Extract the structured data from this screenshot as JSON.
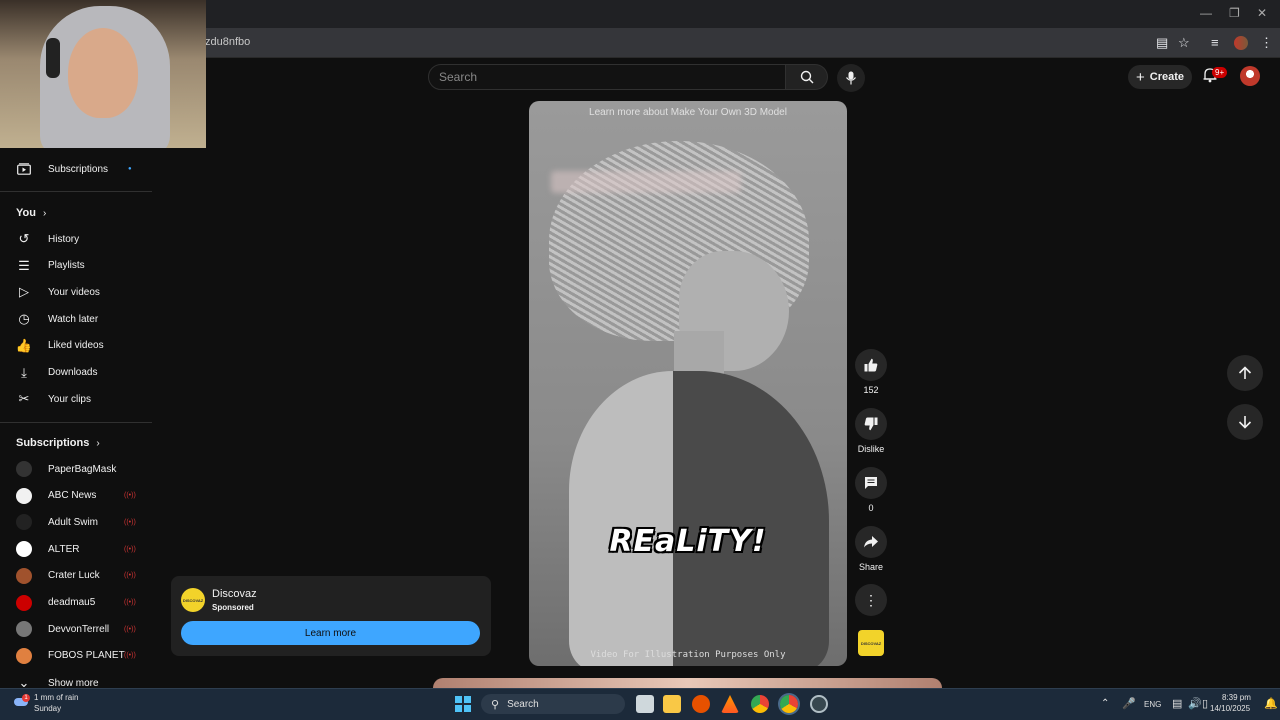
{
  "browser": {
    "url": "zdu8nfbo"
  },
  "header": {
    "search_placeholder": "Search",
    "create_label": "Create",
    "notif_count": "9+"
  },
  "sidebar": {
    "subscriptions_top": "Subscriptions",
    "you_heading": "You",
    "you_items": [
      {
        "label": "History",
        "icon": "history-icon"
      },
      {
        "label": "Playlists",
        "icon": "playlists-icon"
      },
      {
        "label": "Your videos",
        "icon": "your-videos-icon"
      },
      {
        "label": "Watch later",
        "icon": "watch-later-icon"
      },
      {
        "label": "Liked videos",
        "icon": "liked-icon"
      },
      {
        "label": "Downloads",
        "icon": "download-icon"
      },
      {
        "label": "Your clips",
        "icon": "clips-icon"
      }
    ],
    "subs_heading": "Subscriptions",
    "channels": [
      {
        "name": "PaperBagMask",
        "color": "#333333"
      },
      {
        "name": "ABC News",
        "color": "#f1f1f1"
      },
      {
        "name": "Adult Swim",
        "color": "#222222"
      },
      {
        "name": "ALTER",
        "color": "#ffffff"
      },
      {
        "name": "Crater Luck",
        "color": "#a0522d"
      },
      {
        "name": "deadmau5",
        "color": "#cc0000"
      },
      {
        "name": "DevvonTerrell",
        "color": "#777777"
      },
      {
        "name": "FOBOS PLANET",
        "color": "#e08040"
      }
    ],
    "show_more": "Show more"
  },
  "video": {
    "top_caption": "Learn more about Make Your Own 3D Model",
    "overlay_text": "REaLiTY!",
    "disclaimer": "Video For Illustration Purposes Only"
  },
  "actions": {
    "like_count": "152",
    "dislike_label": "Dislike",
    "comment_count": "0",
    "share_label": "Share",
    "ad_thumb_text": "DISCOVAZ"
  },
  "ad": {
    "name": "Discovaz",
    "sponsored": "Sponsored",
    "cta": "Learn more",
    "logo_text": "DISCOVAZ"
  },
  "taskbar": {
    "weather": "1 mm of rain",
    "day": "Sunday",
    "search": "Search",
    "lang": "ENG",
    "time": "8:39 pm",
    "date": "14/10/2025"
  }
}
